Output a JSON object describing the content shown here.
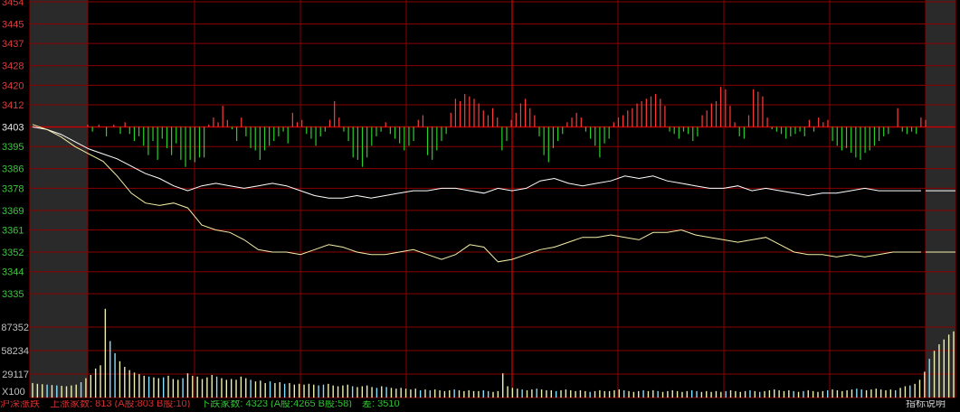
{
  "chart_data": {
    "type": "line",
    "ylim": [
      3331,
      3454
    ],
    "baseline": 3403,
    "price_ticks": [
      {
        "value": 3454,
        "label": "3454",
        "color": "#e03c3c"
      },
      {
        "value": 3445,
        "label": "3445",
        "color": "#e03c3c"
      },
      {
        "value": 3437,
        "label": "3437",
        "color": "#e03c3c"
      },
      {
        "value": 3428,
        "label": "3428",
        "color": "#e03c3c"
      },
      {
        "value": 3420,
        "label": "3420",
        "color": "#e03c3c"
      },
      {
        "value": 3412,
        "label": "3412",
        "color": "#e03c3c"
      },
      {
        "value": 3403,
        "label": "3403",
        "color": "#e8e8e8"
      },
      {
        "value": 3395,
        "label": "3395",
        "color": "#3cc83c"
      },
      {
        "value": 3386,
        "label": "3386",
        "color": "#3cc83c"
      },
      {
        "value": 3378,
        "label": "3378",
        "color": "#3cc83c"
      },
      {
        "value": 3369,
        "label": "3369",
        "color": "#3cc83c"
      },
      {
        "value": 3361,
        "label": "3361",
        "color": "#3cc83c"
      },
      {
        "value": 3352,
        "label": "3352",
        "color": "#3cc83c"
      },
      {
        "value": 3344,
        "label": "3344",
        "color": "#3cc83c"
      },
      {
        "value": 3335,
        "label": "3335",
        "color": "#3cc83c"
      }
    ],
    "volume_ticks": [
      {
        "value": 87352,
        "label": "87352"
      },
      {
        "value": 58234,
        "label": "58234"
      },
      {
        "value": 29117,
        "label": "29117"
      }
    ],
    "volume_max": 116469,
    "volume_scale_label": "X100",
    "series": [
      {
        "color": "#ffffff",
        "values": [
          3403,
          3402,
          3400,
          3397,
          3394,
          3392,
          3390,
          3387,
          3384,
          3382,
          3379,
          3377,
          3379,
          3380,
          3379,
          3378,
          3379,
          3380,
          3379,
          3377,
          3375,
          3374,
          3374,
          3375,
          3374,
          3375,
          3376,
          3377,
          3377,
          3378,
          3378,
          3377,
          3376,
          3378,
          3377,
          3378,
          3381,
          3382,
          3380,
          3379,
          3380,
          3381,
          3383,
          3382,
          3383,
          3381,
          3380,
          3379,
          3378,
          3378,
          3379,
          3377,
          3378,
          3377,
          3376,
          3375,
          3376,
          3376,
          3377,
          3378,
          3377,
          3377,
          3377,
          3377
        ]
      },
      {
        "color": "#f5f0a8",
        "values": [
          3404,
          3402,
          3399,
          3395,
          3392,
          3389,
          3383,
          3376,
          3372,
          3371,
          3372,
          3370,
          3363,
          3361,
          3360,
          3357,
          3353,
          3352,
          3352,
          3351,
          3353,
          3355,
          3354,
          3352,
          3351,
          3351,
          3352,
          3353,
          3351,
          3349,
          3351,
          3355,
          3354,
          3348,
          3349,
          3351,
          3353,
          3354,
          3356,
          3358,
          3358,
          3359,
          3358,
          3357,
          3360,
          3360,
          3361,
          3359,
          3358,
          3357,
          3356,
          3357,
          3358,
          3355,
          3352,
          3351,
          3351,
          3350,
          3351,
          3350,
          3351,
          3352,
          3352,
          3352
        ]
      }
    ],
    "ratio_bars": [
      {
        "x": 0.06,
        "v": 1
      },
      {
        "x": 0.065,
        "v": -2
      },
      {
        "x": 0.072,
        "v": 1
      },
      {
        "x": 0.08,
        "v": -4
      },
      {
        "x": 0.088,
        "v": 1
      },
      {
        "x": 0.095,
        "v": -3
      },
      {
        "x": 0.1,
        "v": 2
      },
      {
        "x": 0.105,
        "v": -3
      },
      {
        "x": 0.11,
        "v": -6
      },
      {
        "x": 0.115,
        "v": -4
      },
      {
        "x": 0.12,
        "v": -8
      },
      {
        "x": 0.125,
        "v": -12
      },
      {
        "x": 0.13,
        "v": -6
      },
      {
        "x": 0.135,
        "v": -14
      },
      {
        "x": 0.14,
        "v": -5
      },
      {
        "x": 0.145,
        "v": -9
      },
      {
        "x": 0.15,
        "v": -12
      },
      {
        "x": 0.155,
        "v": -7
      },
      {
        "x": 0.16,
        "v": -14
      },
      {
        "x": 0.165,
        "v": -17
      },
      {
        "x": 0.17,
        "v": -14
      },
      {
        "x": 0.175,
        "v": -15
      },
      {
        "x": 0.18,
        "v": -13
      },
      {
        "x": 0.185,
        "v": -13
      },
      {
        "x": 0.19,
        "v": 1
      },
      {
        "x": 0.195,
        "v": 4
      },
      {
        "x": 0.2,
        "v": 2
      },
      {
        "x": 0.205,
        "v": 9
      },
      {
        "x": 0.21,
        "v": 3
      },
      {
        "x": 0.215,
        "v": -1
      },
      {
        "x": 0.22,
        "v": -6
      },
      {
        "x": 0.225,
        "v": 4
      },
      {
        "x": 0.23,
        "v": -4
      },
      {
        "x": 0.235,
        "v": -9
      },
      {
        "x": 0.24,
        "v": -10
      },
      {
        "x": 0.245,
        "v": -14
      },
      {
        "x": 0.25,
        "v": -10
      },
      {
        "x": 0.255,
        "v": -8
      },
      {
        "x": 0.26,
        "v": -6
      },
      {
        "x": 0.265,
        "v": -4
      },
      {
        "x": 0.27,
        "v": -2
      },
      {
        "x": 0.275,
        "v": -7
      },
      {
        "x": 0.28,
        "v": 6
      },
      {
        "x": 0.285,
        "v": 2
      },
      {
        "x": 0.29,
        "v": 3
      },
      {
        "x": 0.295,
        "v": -3
      },
      {
        "x": 0.3,
        "v": -5
      },
      {
        "x": 0.305,
        "v": -8
      },
      {
        "x": 0.31,
        "v": -4
      },
      {
        "x": 0.315,
        "v": -2
      },
      {
        "x": 0.32,
        "v": 3
      },
      {
        "x": 0.325,
        "v": 11
      },
      {
        "x": 0.33,
        "v": 4
      },
      {
        "x": 0.335,
        "v": -2
      },
      {
        "x": 0.34,
        "v": -6
      },
      {
        "x": 0.345,
        "v": -13
      },
      {
        "x": 0.35,
        "v": -14
      },
      {
        "x": 0.355,
        "v": -17
      },
      {
        "x": 0.36,
        "v": -13
      },
      {
        "x": 0.365,
        "v": -8
      },
      {
        "x": 0.37,
        "v": -4
      },
      {
        "x": 0.375,
        "v": -2
      },
      {
        "x": 0.38,
        "v": 2
      },
      {
        "x": 0.385,
        "v": -3
      },
      {
        "x": 0.39,
        "v": -5
      },
      {
        "x": 0.395,
        "v": -7
      },
      {
        "x": 0.4,
        "v": -10
      },
      {
        "x": 0.405,
        "v": -8
      },
      {
        "x": 0.41,
        "v": -6
      },
      {
        "x": 0.415,
        "v": 3
      },
      {
        "x": 0.42,
        "v": 5
      },
      {
        "x": 0.425,
        "v": -12
      },
      {
        "x": 0.43,
        "v": -14
      },
      {
        "x": 0.435,
        "v": -10
      },
      {
        "x": 0.44,
        "v": -6
      },
      {
        "x": 0.445,
        "v": -3
      },
      {
        "x": 0.45,
        "v": 6
      },
      {
        "x": 0.455,
        "v": 12
      },
      {
        "x": 0.46,
        "v": 11
      },
      {
        "x": 0.465,
        "v": 14
      },
      {
        "x": 0.47,
        "v": 13
      },
      {
        "x": 0.475,
        "v": 12
      },
      {
        "x": 0.48,
        "v": 10
      },
      {
        "x": 0.485,
        "v": 7
      },
      {
        "x": 0.49,
        "v": 5
      },
      {
        "x": 0.495,
        "v": 8
      },
      {
        "x": 0.5,
        "v": 4
      },
      {
        "x": 0.505,
        "v": -10
      },
      {
        "x": 0.51,
        "v": -6
      },
      {
        "x": 0.515,
        "v": 3
      },
      {
        "x": 0.52,
        "v": 6
      },
      {
        "x": 0.525,
        "v": 10
      },
      {
        "x": 0.53,
        "v": 12
      },
      {
        "x": 0.535,
        "v": 8
      },
      {
        "x": 0.54,
        "v": 5
      },
      {
        "x": 0.545,
        "v": -4
      },
      {
        "x": 0.55,
        "v": -12
      },
      {
        "x": 0.555,
        "v": -15
      },
      {
        "x": 0.56,
        "v": -9
      },
      {
        "x": 0.565,
        "v": -6
      },
      {
        "x": 0.57,
        "v": -3
      },
      {
        "x": 0.575,
        "v": 2
      },
      {
        "x": 0.58,
        "v": 4
      },
      {
        "x": 0.585,
        "v": 6
      },
      {
        "x": 0.59,
        "v": 4
      },
      {
        "x": 0.595,
        "v": -2
      },
      {
        "x": 0.6,
        "v": -5
      },
      {
        "x": 0.605,
        "v": -8
      },
      {
        "x": 0.61,
        "v": -13
      },
      {
        "x": 0.615,
        "v": -7
      },
      {
        "x": 0.62,
        "v": -5
      },
      {
        "x": 0.625,
        "v": 2
      },
      {
        "x": 0.63,
        "v": 4
      },
      {
        "x": 0.635,
        "v": 5
      },
      {
        "x": 0.64,
        "v": 7
      },
      {
        "x": 0.645,
        "v": 8
      },
      {
        "x": 0.65,
        "v": 10
      },
      {
        "x": 0.655,
        "v": 11
      },
      {
        "x": 0.66,
        "v": 12
      },
      {
        "x": 0.665,
        "v": 13
      },
      {
        "x": 0.67,
        "v": 14
      },
      {
        "x": 0.675,
        "v": 12
      },
      {
        "x": 0.68,
        "v": 9
      },
      {
        "x": 0.685,
        "v": -2
      },
      {
        "x": 0.69,
        "v": -3
      },
      {
        "x": 0.695,
        "v": -5
      },
      {
        "x": 0.7,
        "v": -2
      },
      {
        "x": 0.705,
        "v": -3
      },
      {
        "x": 0.71,
        "v": -6
      },
      {
        "x": 0.715,
        "v": -4
      },
      {
        "x": 0.72,
        "v": 5
      },
      {
        "x": 0.725,
        "v": 7
      },
      {
        "x": 0.73,
        "v": 10
      },
      {
        "x": 0.735,
        "v": 11
      },
      {
        "x": 0.74,
        "v": 17
      },
      {
        "x": 0.745,
        "v": 16
      },
      {
        "x": 0.75,
        "v": 9
      },
      {
        "x": 0.755,
        "v": 2
      },
      {
        "x": 0.76,
        "v": -4
      },
      {
        "x": 0.765,
        "v": -5
      },
      {
        "x": 0.77,
        "v": 5
      },
      {
        "x": 0.775,
        "v": 16
      },
      {
        "x": 0.78,
        "v": 15
      },
      {
        "x": 0.785,
        "v": 13
      },
      {
        "x": 0.79,
        "v": 4
      },
      {
        "x": 0.795,
        "v": -1
      },
      {
        "x": 0.8,
        "v": -2
      },
      {
        "x": 0.805,
        "v": -3
      },
      {
        "x": 0.81,
        "v": -5
      },
      {
        "x": 0.815,
        "v": -4
      },
      {
        "x": 0.82,
        "v": -3
      },
      {
        "x": 0.825,
        "v": -2
      },
      {
        "x": 0.83,
        "v": -4
      },
      {
        "x": 0.835,
        "v": 3
      },
      {
        "x": 0.84,
        "v": -2
      },
      {
        "x": 0.845,
        "v": 4
      },
      {
        "x": 0.85,
        "v": 2
      },
      {
        "x": 0.855,
        "v": 3
      },
      {
        "x": 0.86,
        "v": -6
      },
      {
        "x": 0.865,
        "v": -8
      },
      {
        "x": 0.87,
        "v": -10
      },
      {
        "x": 0.875,
        "v": -9
      },
      {
        "x": 0.88,
        "v": -11
      },
      {
        "x": 0.885,
        "v": -13
      },
      {
        "x": 0.89,
        "v": -14
      },
      {
        "x": 0.895,
        "v": -11
      },
      {
        "x": 0.9,
        "v": -10
      },
      {
        "x": 0.905,
        "v": -8
      },
      {
        "x": 0.91,
        "v": -6
      },
      {
        "x": 0.915,
        "v": -4
      },
      {
        "x": 0.92,
        "v": -3
      },
      {
        "x": 0.93,
        "v": 8
      },
      {
        "x": 0.935,
        "v": -2
      },
      {
        "x": 0.94,
        "v": -3
      },
      {
        "x": 0.945,
        "v": -2
      },
      {
        "x": 0.95,
        "v": -3
      },
      {
        "x": 0.955,
        "v": 4
      },
      {
        "x": 0.96,
        "v": 3
      }
    ],
    "volume_bars": [
      18000,
      17000,
      16500,
      16000,
      15500,
      15000,
      14500,
      14000,
      15000,
      16000,
      19000,
      24000,
      28000,
      36000,
      40000,
      110000,
      70000,
      55000,
      45000,
      38000,
      34000,
      31000,
      29000,
      27000,
      26000,
      25000,
      24000,
      25000,
      27000,
      23000,
      22000,
      24000,
      30000,
      27000,
      26000,
      23000,
      25000,
      28000,
      26000,
      24000,
      22000,
      23000,
      22000,
      26000,
      24000,
      22000,
      20000,
      21000,
      18000,
      20000,
      18000,
      19000,
      17000,
      18000,
      16000,
      17000,
      16000,
      17000,
      16000,
      15000,
      16000,
      17000,
      15000,
      14000,
      15000,
      16000,
      14000,
      13000,
      14000,
      15000,
      13000,
      12000,
      14000,
      13000,
      12000,
      11000,
      12000,
      11000,
      10000,
      11000,
      9000,
      10000,
      9000,
      10000,
      9000,
      8000,
      9000,
      10000,
      9000,
      8000,
      9000,
      8000,
      8000,
      9000,
      8000,
      7000,
      8000,
      30000,
      14000,
      12000,
      11000,
      10000,
      9000,
      10000,
      11000,
      10000,
      9000,
      9000,
      8000,
      9000,
      10000,
      9000,
      8000,
      9000,
      8000,
      7000,
      8000,
      9000,
      8000,
      8000,
      9000,
      10000,
      9000,
      8000,
      7000,
      8000,
      9000,
      8000,
      9000,
      8000,
      7000,
      8000,
      9000,
      8000,
      7000,
      8000,
      9000,
      8000,
      7000,
      8000,
      7000,
      8000,
      7000,
      8000,
      9000,
      8000,
      7000,
      8000,
      9000,
      8000,
      7000,
      8000,
      9000,
      10000,
      9000,
      8000,
      9000,
      8000,
      7000,
      8000,
      9000,
      8000,
      7000,
      8000,
      9000,
      10000,
      9000,
      8000,
      9000,
      10000,
      11000,
      10000,
      9000,
      10000,
      11000,
      10000,
      9000,
      10000,
      9000,
      12000,
      14000,
      15000,
      17000,
      22000,
      32000,
      48000,
      58000,
      66000,
      72000,
      78000,
      82000
    ]
  },
  "ui": {
    "status_segments": [
      {
        "text": "沪深涨跌",
        "tone": "red"
      },
      {
        "text": "上涨家数: 813 (A股:803 B股:10)",
        "tone": "red"
      },
      {
        "text": "下跌家数: 4323 (A股:4265 B股:58)",
        "tone": "green"
      },
      {
        "text": "差: 3510",
        "tone": "green"
      }
    ],
    "help_link": "指标说明"
  },
  "colors": {
    "grid": "#8a0000",
    "up": "#ff3c3c",
    "down": "#28d028",
    "volume": "#f0f0b0",
    "volume_up": "#88e0ff",
    "session_shade": "#2a2a2a"
  }
}
